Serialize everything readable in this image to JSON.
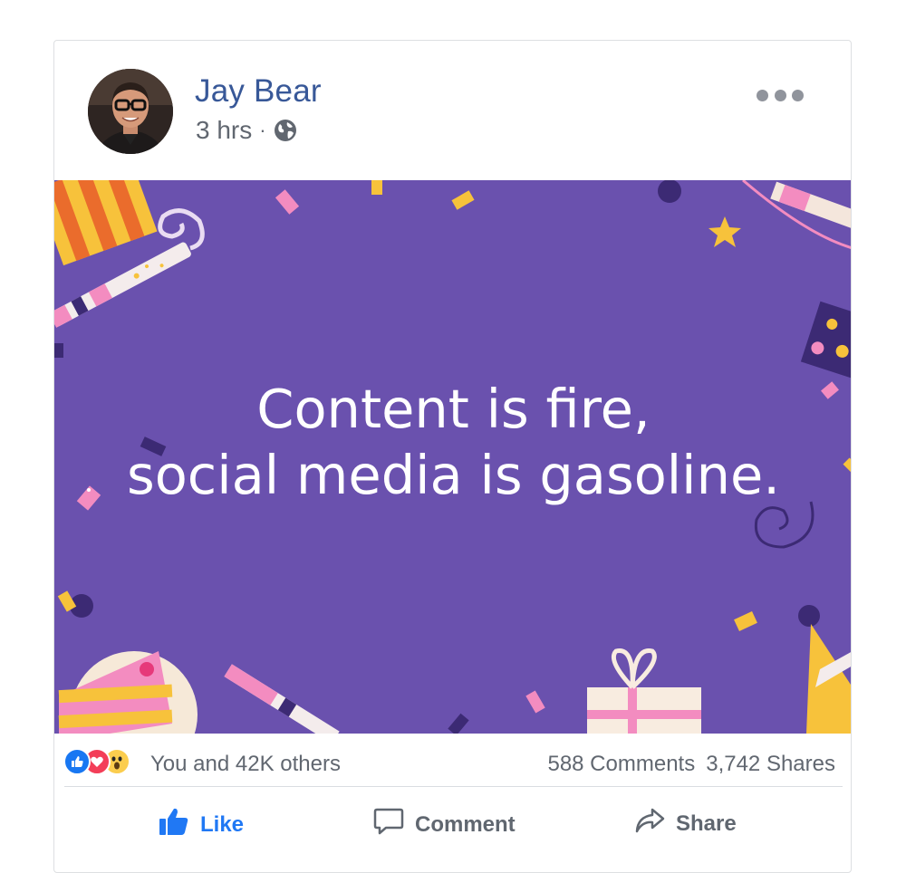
{
  "post": {
    "author": "Jay Bear",
    "time": "3 hrs",
    "separator": "·",
    "privacy_icon": "globe-icon",
    "image_text": {
      "line1": "Content is fire,",
      "line2": "social media is gasoline."
    },
    "image_bg": "#6a51ae"
  },
  "stats": {
    "reactions": [
      "like",
      "love",
      "wow"
    ],
    "reaction_text": "You and 42K others",
    "comments": "588 Comments",
    "shares": "3,742 Shares"
  },
  "actions": {
    "like": "Like",
    "comment": "Comment",
    "share": "Share"
  },
  "colors": {
    "author": "#385898",
    "like_active": "#2078f4",
    "secondary": "#616770"
  }
}
